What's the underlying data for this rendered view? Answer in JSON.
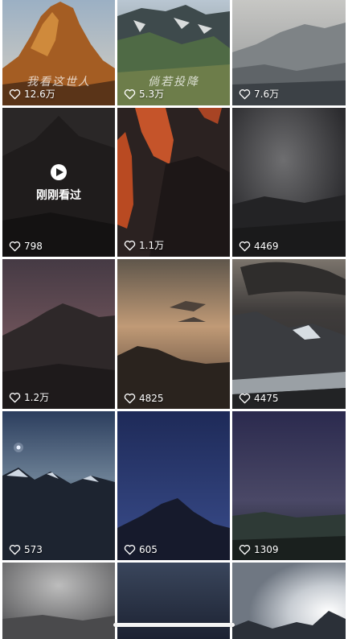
{
  "grid": {
    "tiles": [
      {
        "likes": "12.6万",
        "overlay_text": "我看这世人",
        "theme": "golden-peak"
      },
      {
        "likes": "5.3万",
        "overlay_text": "倘若投降",
        "theme": "green-ridge"
      },
      {
        "likes": "7.6万",
        "theme": "misty-range"
      },
      {
        "likes": "798",
        "theme": "dark-peak",
        "recently_watched_label": "刚刚看过"
      },
      {
        "likes": "1.1万",
        "theme": "red-cliff"
      },
      {
        "likes": "4469",
        "theme": "storm-clouds"
      },
      {
        "likes": "1.2万",
        "theme": "dusk-peak"
      },
      {
        "likes": "4825",
        "theme": "sepia-sunset"
      },
      {
        "likes": "4475",
        "theme": "glacier-clouds"
      },
      {
        "likes": "573",
        "theme": "night-snow-star"
      },
      {
        "likes": "605",
        "theme": "blue-night-peak"
      },
      {
        "likes": "1309",
        "theme": "purple-night"
      },
      {
        "theme": "grey-haze"
      },
      {
        "theme": "dark-blue-sky"
      },
      {
        "theme": "light-rays"
      }
    ]
  },
  "icons": {
    "like": "heart-outline-icon",
    "play": "play-icon"
  },
  "colors": {
    "text": "#ffffff",
    "background": "#ffffff"
  }
}
